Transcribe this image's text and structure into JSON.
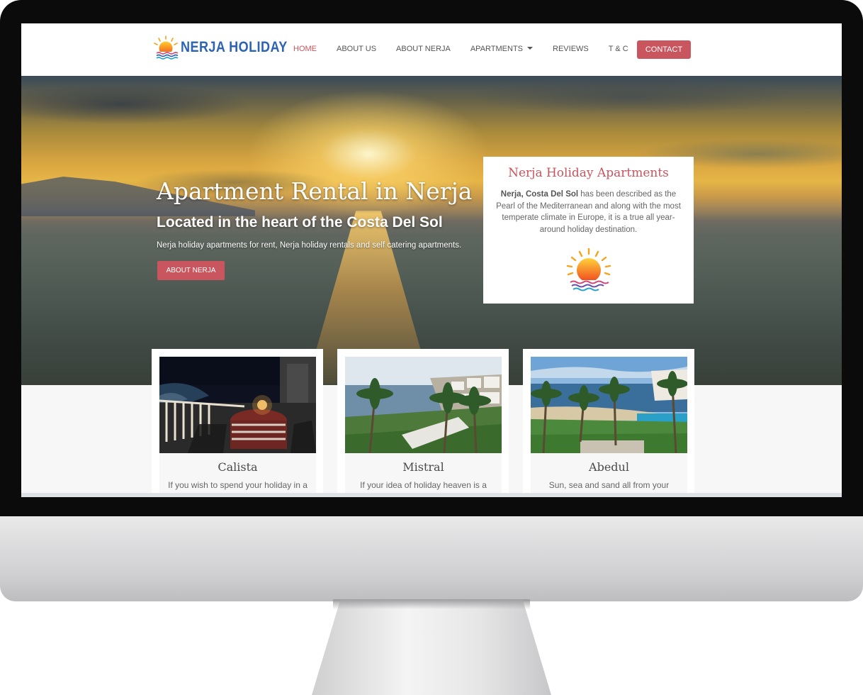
{
  "brand": {
    "name": "NERJA HOLIDAY",
    "accent_color": "#c9565f",
    "logo_text_color": "#2d63b4"
  },
  "nav": {
    "items": [
      {
        "label": "HOME",
        "active": true
      },
      {
        "label": "ABOUT US"
      },
      {
        "label": "ABOUT NERJA"
      },
      {
        "label": "APARTMENTS",
        "has_dropdown": true
      },
      {
        "label": "REVIEWS"
      },
      {
        "label": "T & C"
      }
    ],
    "contact_label": "CONTACT"
  },
  "hero": {
    "title": "Apartment Rental in Nerja",
    "subtitle": "Located in the heart of the Costa Del Sol",
    "description": "Nerja holiday apartments for rent, Nerja holiday rentals and self catering apartments.",
    "button_label": "ABOUT NERJA"
  },
  "info_card": {
    "title": "Nerja Holiday Apartments",
    "text_bold": "Nerja, Costa Del Sol",
    "text_rest": " has been described as the Pearl of the Mediterranean and along with the most temperate climate in Europe, it is a true all year-around holiday destination.",
    "icon": "sun-over-waves-icon"
  },
  "apartments": [
    {
      "name": "Calista",
      "excerpt": "If you wish to spend your holiday in a",
      "photo": "night-balcony-sea-view"
    },
    {
      "name": "Mistral",
      "excerpt": "If your idea of holiday heaven is a",
      "photo": "palm-trees-coastline"
    },
    {
      "name": "Abedul",
      "excerpt": "Sun, sea and sand all from your",
      "photo": "beach-pool-palms"
    }
  ]
}
